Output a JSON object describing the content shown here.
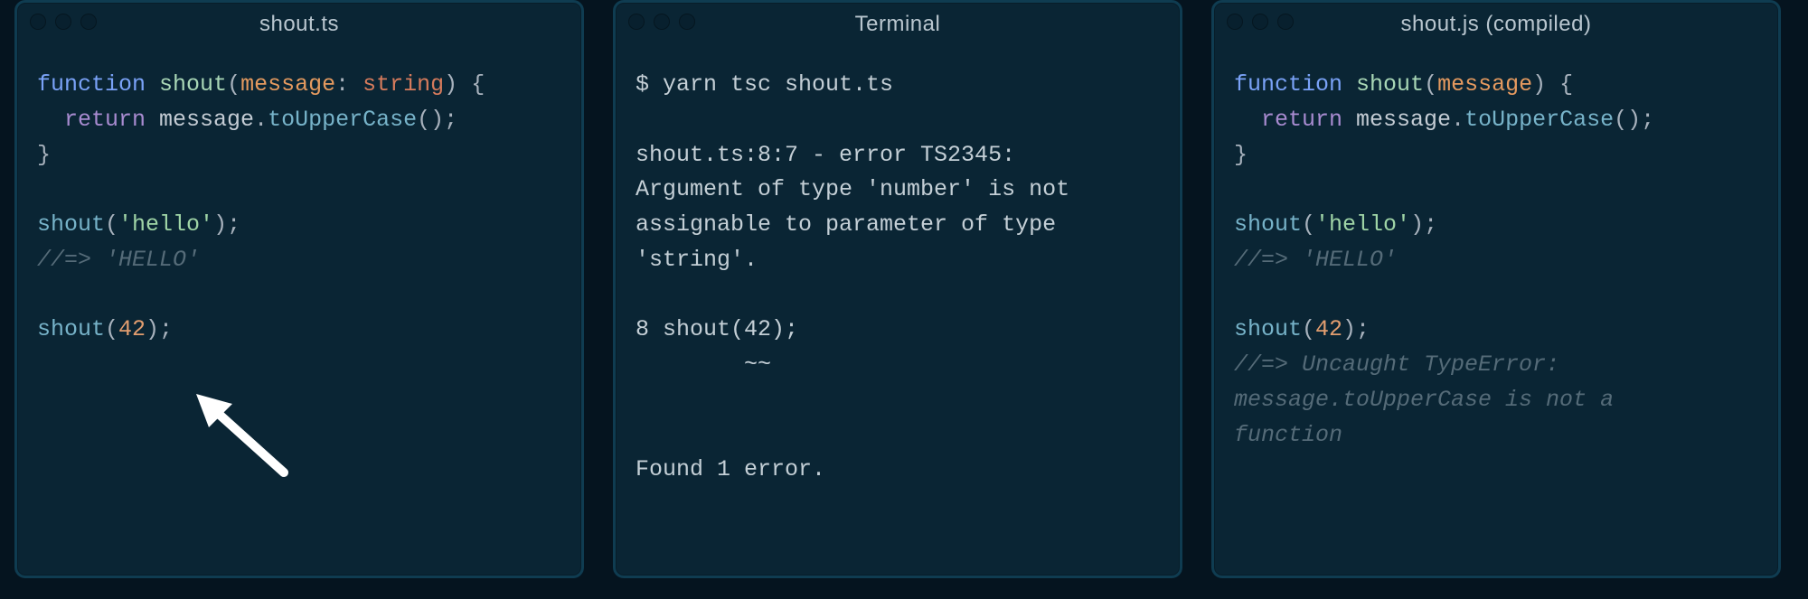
{
  "windows": {
    "src": {
      "title": "shout.ts"
    },
    "term": {
      "title": "Terminal"
    },
    "out": {
      "title": "shout.js (compiled)"
    }
  },
  "src": {
    "kw_function": "function",
    "fn_name": "shout",
    "param": "message",
    "type_kw": "string",
    "kw_return": "return",
    "id_message": "message",
    "method": "toUpperCase",
    "call1": "shout",
    "str_hello": "'hello'",
    "comment_hello": "//=> 'HELLO'",
    "call2": "shout",
    "num_42": "42"
  },
  "term": {
    "l1": "$ yarn tsc shout.ts",
    "l3": "shout.ts:8:7 - error TS2345:",
    "l4": "Argument of type 'number' is not",
    "l5": "assignable to parameter of type",
    "l6": "'string'.",
    "l8": "8 shout(42);",
    "l9": "        ~~",
    "l12": "Found 1 error."
  },
  "out": {
    "kw_function": "function",
    "fn_name": "shout",
    "param": "message",
    "kw_return": "return",
    "id_message": "message",
    "method": "toUpperCase",
    "call1": "shout",
    "str_hello": "'hello'",
    "comment_hello": "//=> 'HELLO'",
    "call2": "shout",
    "num_42": "42",
    "err1": "//=> Uncaught TypeError:",
    "err2": "message.toUpperCase is not a",
    "err3": "function"
  }
}
